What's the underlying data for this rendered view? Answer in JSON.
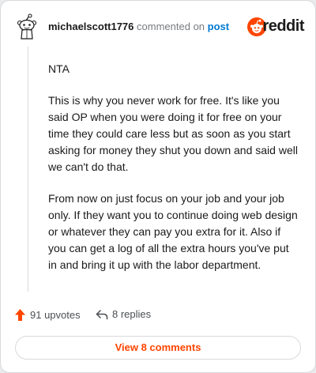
{
  "header": {
    "username": "michaelscott1776",
    "action_text": "commented on",
    "post_link": "post",
    "brand_name": "reddit",
    "avatar_icon": "snoo-avatar-icon",
    "brand_icon": "reddit-logo-icon"
  },
  "comment": {
    "paragraphs": [
      "NTA",
      "This is why you never work for free. It's like you said OP when you were doing it for free on your time they could care less but as soon as you start asking for money they shut you down and said well we can't do that.",
      "From now on just focus on your job and your job only. If they want you to continue doing web design or whatever they can pay you extra for it. Also if you can get a log of all the extra hours you've put in and bring it up with the labor department."
    ]
  },
  "actions": {
    "upvotes_label": "91 upvotes",
    "replies_label": "8 replies"
  },
  "footer": {
    "view_button": "View 8 comments"
  },
  "colors": {
    "accent": "#ff4500",
    "link": "#0079d3",
    "text": "#1a1a1b",
    "muted": "#787c7e"
  }
}
